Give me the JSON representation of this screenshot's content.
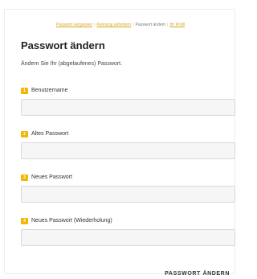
{
  "nav": {
    "forgot_password": "Passwort vergessen",
    "send_registration": "Kennung anfordern",
    "change_password": "Passwort ändern",
    "profile": "Ihr Profil"
  },
  "page": {
    "title": "Passwort ändern",
    "description": "Ändern Sie Ihr (abgelaufenes) Passwort."
  },
  "fields": [
    {
      "num": "1",
      "label": "Benutzername",
      "value": ""
    },
    {
      "num": "2",
      "label": "Altes Passwort",
      "value": ""
    },
    {
      "num": "3",
      "label": "Neues Passwort",
      "value": ""
    },
    {
      "num": "4",
      "label": "Neues Passwort (Wiederholung)",
      "value": ""
    }
  ],
  "submit_label": "PASSWORT ÄNDERN",
  "colors": {
    "accent": "#f2b705",
    "link": "#d8a51c"
  }
}
